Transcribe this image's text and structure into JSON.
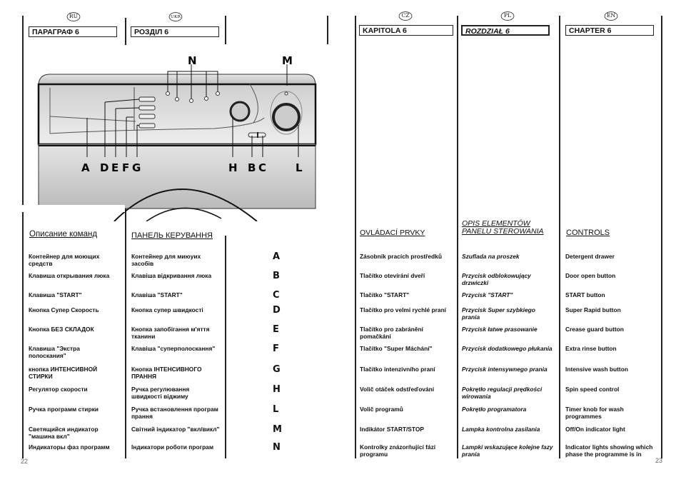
{
  "left_page": {
    "ru": {
      "lang_badge": "RU",
      "chapter": "ПАРАГРАФ 6",
      "section_title": "Описание команд"
    },
    "uk": {
      "lang_badge": "UKR",
      "chapter": "РОЗДІЛ 6",
      "section_title": "ПАНЕЛЬ КЕРУВАННЯ"
    },
    "page_number": "22"
  },
  "right_page": {
    "cz": {
      "lang_badge": "CZ",
      "chapter": "KAPITOLA 6",
      "section_title": "OVLÁDACÍ PRVKY"
    },
    "pl": {
      "lang_badge": "PL",
      "chapter": "ROZDZIAŁ 6",
      "section_title": "OPIS ELEMENTÓW PANELU STEROWANIA"
    },
    "en": {
      "lang_badge": "EN",
      "chapter": "CHAPTER 6",
      "section_title": "CONTROLS"
    },
    "page_number": "23"
  },
  "diagram_labels": {
    "N": "N",
    "M": "M",
    "A": "A",
    "D": "D",
    "E": "E",
    "F": "F",
    "G": "G",
    "H": "H",
    "B": "B",
    "C": "C",
    "L": "L"
  },
  "rows": [
    {
      "letter": "A",
      "ru": "Контейнер для моющих средств",
      "uk": "Контейнер для миюуих засобів",
      "cz": "Zásobník pracích prostředků",
      "pl": "Szuflada na proszek",
      "en": "Detergent drawer"
    },
    {
      "letter": "B",
      "ru": "Клавиша открывания люка",
      "uk": "Клавіша відкривання люка",
      "cz": "Tlačítko otevírání dveří",
      "pl": "Przycisk odblokowujący drzwiczki",
      "en": "Door open button"
    },
    {
      "letter": "C",
      "ru": "Клавиша \"START\"",
      "uk": "Клавіша \"START\"",
      "cz": "Tlačítko \"START\"",
      "pl": "Przycisk \"START\"",
      "en": "START button"
    },
    {
      "letter": "D",
      "ru": "Кнопка Супер Скорость",
      "uk": "Кнопка супер швидкості",
      "cz": "Tlačítko pro velmi rychlé praní",
      "pl": "Przycisk Super szybkiego prania",
      "en": "Super Rapid button"
    },
    {
      "letter": "E",
      "ru": "Кнопка БЕЗ СКЛАДОК",
      "uk": "Кнопка запобігання м'яття тканини",
      "cz": "Tlačítko pro zabránění pomačkání",
      "pl": "Przycisk łatwe prasowanie",
      "en": "Crease guard button"
    },
    {
      "letter": "F",
      "ru": "Клавиша \"Экстра полоскания\"",
      "uk": "Клавіша \"суперполоскання\"",
      "cz": "Tlačítko \"Super Máchání\"",
      "pl": "Przycisk dodatkowego płukania",
      "en": "Extra rinse button"
    },
    {
      "letter": "G",
      "ru": "кнопка ИНТЕНСИВНОЙ СТИРКИ",
      "uk": "Кнопка ІНТЕНСИВНОГО ПРАННЯ",
      "cz": "Tlačítko intenzivního praní",
      "pl": "Przycisk intensywnego prania",
      "en": "Intensive wash button"
    },
    {
      "letter": "H",
      "ru": "Регулятор скорости",
      "uk": "Ручка регулювання швидкості віджиму",
      "cz": "Volič otáček odstřeďování",
      "pl": "Pokrętło regulacji prędkości wirowania",
      "en": "Spin speed control"
    },
    {
      "letter": "L",
      "ru": "Ручка программ стирки",
      "uk": "Ручка встановлення програм прання",
      "cz": "Volič programů",
      "pl": "Pokrętło programatora",
      "en": "Timer knob for wash programmes"
    },
    {
      "letter": "M",
      "ru": "Светящийся индикатор \"машина вкл\"",
      "uk": "Світний індикатор \"вкл/викл\"",
      "cz": "Indikátor START/STOP",
      "pl": "Lampka kontrolna zasilania",
      "en": "Off/On indicator light"
    },
    {
      "letter": "N",
      "ru": "Индикаторы фаз программ",
      "uk": "Індикатори роботи програм",
      "cz": "Kontrolky znázorňující fázi programu",
      "pl": "Lampki wskazujące kolejne fazy prania",
      "en": "Indicator lights showing which phase the programme is in"
    }
  ]
}
